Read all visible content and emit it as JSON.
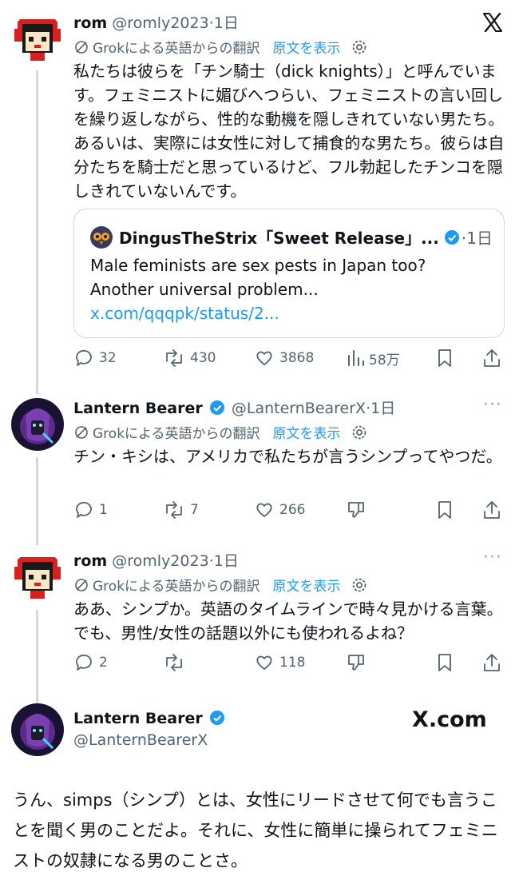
{
  "app": {
    "logo": "X",
    "logo_icon": "x-logo-icon"
  },
  "tweets": [
    {
      "name": "rom",
      "handle": "@romly2023",
      "time": "·1日",
      "translation": {
        "label": "Grokによる英語からの翻訳",
        "show_original": "原文を表示"
      },
      "text": "私たちは彼らを「チン騎士（dick knights）」と呼んでいます。フェミニストに媚びへつらい、フェミニストの言い回しを繰り返しながら、性的な動機を隠しきれていない男たち。あるいは、実際には女性に対して捕食的な男たち。彼らは自分たちを騎士だと思っているけど、フル勃起したチンコを隠しきれていないんです。",
      "quote": {
        "name": "DingusTheStrix「Sweet Release」...",
        "time": "·1日",
        "text": "Male feminists are sex pests in Japan too? Another universal problem...",
        "link": "x.com/qqqpk/status/2..."
      },
      "actions": {
        "replies": "32",
        "retweets": "430",
        "likes": "3868",
        "views": "58万"
      }
    },
    {
      "name": "Lantern Bearer",
      "handle": "@LanternBearerX",
      "time": "·1日",
      "more": "···",
      "translation": {
        "label": "Grokによる英語からの翻訳",
        "show_original": "原文を表示"
      },
      "text": "チン・キシは、アメリカで私たちが言うシンプってやつだ。",
      "actions": {
        "replies": "1",
        "retweets": "7",
        "likes": "266"
      }
    },
    {
      "name": "rom",
      "handle": "@romly2023",
      "time": "·1日",
      "more": "···",
      "translation": {
        "label": "Grokによる英語からの翻訳",
        "show_original": "原文を表示"
      },
      "text": "ああ、シンプか。英語のタイムラインで時々見かける言葉。でも、男性/女性の話題以外にも使われるよね？",
      "actions": {
        "replies": "2",
        "retweets": "",
        "likes": "118"
      }
    }
  ],
  "embed": {
    "name": "Lantern Bearer",
    "handle": "@LanternBearerX",
    "brand": "X.com",
    "text": "うん、simps（シンプ）とは、女性にリードさせて何でも言うことを聞く男のことだよ。それに、女性に簡単に操られてフェミニストの奴隷になる男のことさ。"
  },
  "colors": {
    "accent": "#1d9bf0",
    "muted": "#536471",
    "border": "#cfd9de"
  }
}
